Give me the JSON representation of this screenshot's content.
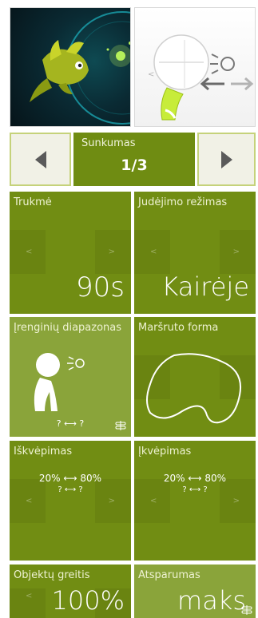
{
  "difficulty": {
    "label": "Sunkumas",
    "value": "1/3"
  },
  "tiles": {
    "duration": {
      "label": "Trukmė",
      "value": "90s"
    },
    "movement_mode": {
      "label": "Judėjimo režimas",
      "value": "Kairėje"
    },
    "device_range": {
      "label": "Įrenginių diapazonas",
      "range": "? ⟷ ?"
    },
    "route_shape": {
      "label": "Maršruto forma"
    },
    "exhale": {
      "label": "Iškvėpimas",
      "range": "20% ⟷ 80%",
      "sub": "? ⟷ ?"
    },
    "inhale": {
      "label": "Įkvėpimas",
      "range": "20% ⟷ 80%",
      "sub": "? ⟷ ?"
    },
    "object_speed": {
      "label": "Objektų greitis",
      "value": "100%"
    },
    "resistance": {
      "label": "Atsparumas",
      "value": "maks"
    }
  },
  "nav": {
    "left": "<",
    "right": ">"
  },
  "colors": {
    "tile": "#718d13",
    "tile_light": "#8aa43a",
    "border": "#c5d27a"
  }
}
